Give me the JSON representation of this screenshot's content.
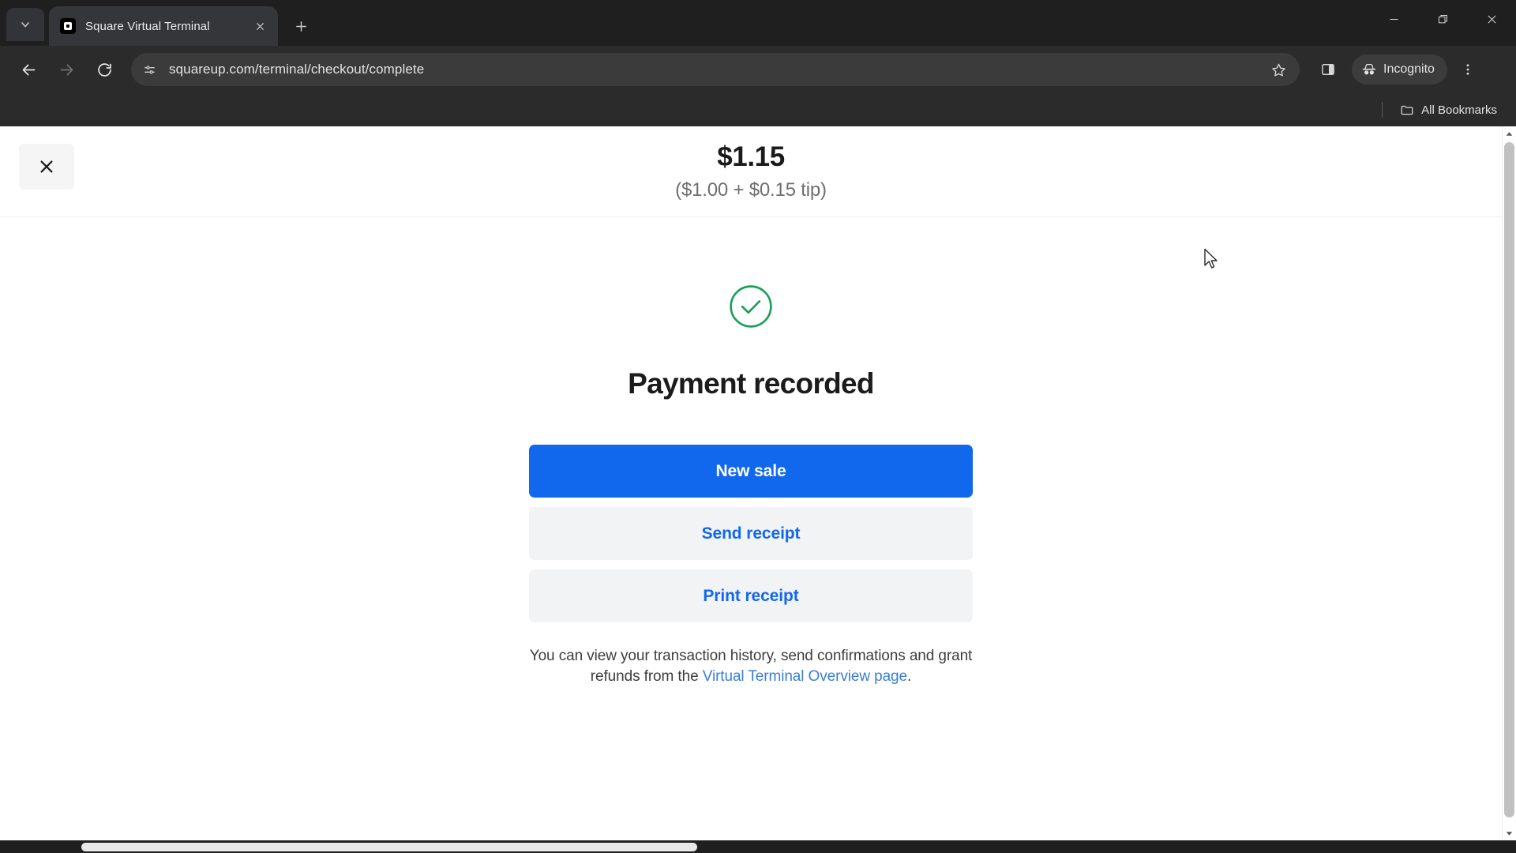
{
  "browser": {
    "tab": {
      "title": "Square Virtual Terminal",
      "favicon_name": "square-favicon"
    },
    "new_tab_label": "+",
    "toolbar": {
      "url": "squareup.com/terminal/checkout/complete",
      "back_icon": "back-arrow-icon",
      "forward_icon": "forward-arrow-icon",
      "reload_icon": "reload-icon",
      "site_info_icon": "site-settings-icon",
      "bookmark_icon": "star-icon",
      "side_panel_icon": "side-panel-icon",
      "menu_icon": "three-dot-menu-icon"
    },
    "profile": {
      "label": "Incognito",
      "icon": "incognito-icon"
    },
    "bookmarks": {
      "all_bookmarks_label": "All Bookmarks",
      "folder_icon": "folder-icon"
    },
    "window_controls": {
      "minimize": "minimize-icon",
      "maximize": "restore-icon",
      "close": "close-icon"
    }
  },
  "page": {
    "header": {
      "close_label": "×",
      "amount": "$1.15",
      "amount_breakdown": "($1.00 + $0.15 tip)"
    },
    "status": {
      "icon": "check-circle-icon",
      "icon_color": "#19a05a",
      "headline": "Payment recorded"
    },
    "actions": [
      {
        "label": "New sale",
        "style": "primary",
        "name": "new-sale-button"
      },
      {
        "label": "Send receipt",
        "style": "secondary",
        "name": "send-receipt-button"
      },
      {
        "label": "Print receipt",
        "style": "secondary",
        "name": "print-receipt-button"
      }
    ],
    "footnote": {
      "text_before": "You can view your transaction history, send confirmations and grant refunds from the ",
      "link_text": "Virtual Terminal Overview page",
      "text_after": "."
    },
    "colors": {
      "primary_blue": "#1268ec",
      "link_blue": "#3a7fd5",
      "success_green": "#19a05a",
      "secondary_bg": "#f2f3f5"
    }
  }
}
